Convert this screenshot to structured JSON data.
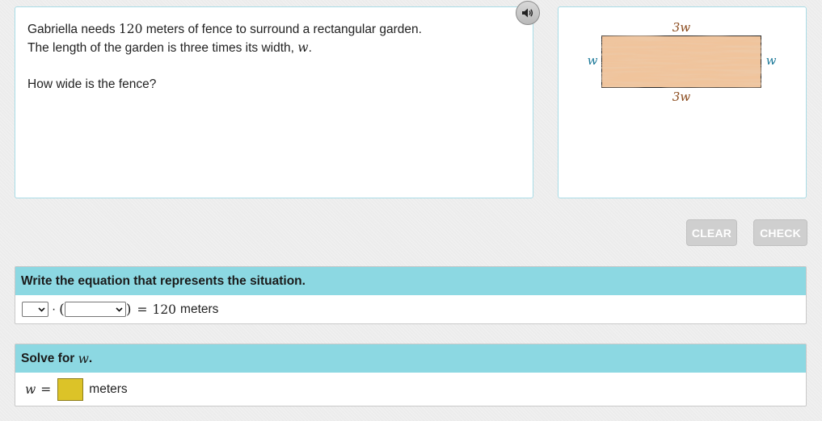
{
  "problem": {
    "line1_pre": "Gabriella needs ",
    "line1_num": "120",
    "line1_post": " meters of fence to surround a rectangular garden.",
    "line2_pre": "The length of the garden is three times its width, ",
    "line2_var": "w",
    "line2_post": ".",
    "question": "How wide is the fence?"
  },
  "audio": {
    "icon": "speaker-icon"
  },
  "figure": {
    "top_label": "3w",
    "bottom_label": "3w",
    "left_label": "w",
    "right_label": "w",
    "garden_color": "#f0c49c",
    "length_label_color": "#8a4a1c",
    "width_label_color": "#1e7a9a"
  },
  "buttons": {
    "clear": "CLEAR",
    "check": "CHECK"
  },
  "equation_section": {
    "header": "Write the equation that represents the situation.",
    "dot": "·",
    "open_paren": "(",
    "close_paren": ")",
    "equals": "=",
    "value": "120",
    "unit": "meters",
    "select1_value": "",
    "select2_value": ""
  },
  "solve_section": {
    "header_pre": "Solve for ",
    "header_var": "w",
    "header_post": ".",
    "var": "w",
    "equals": "=",
    "unit": "meters"
  },
  "colors": {
    "section_header_bg": "#8cd8e2",
    "answer_box": "#dcc328",
    "panel_border": "#a9dce6"
  }
}
